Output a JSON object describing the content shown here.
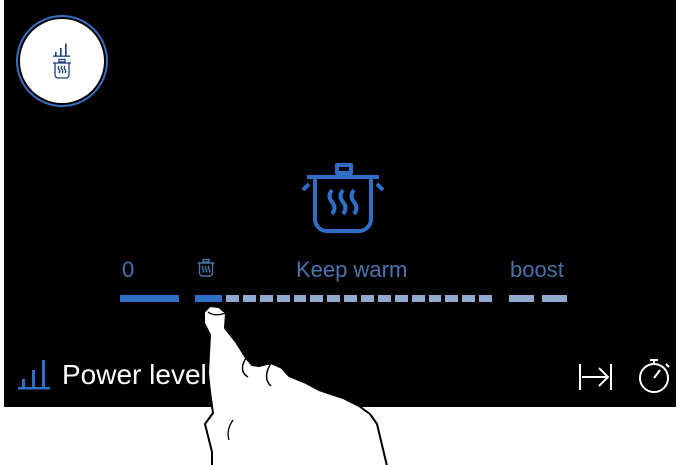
{
  "mode_button": {
    "icons": [
      "bars-icon",
      "steaming-pot-icon"
    ]
  },
  "main_icon": "steaming-pot-icon",
  "scale": {
    "labels": {
      "zero": "0",
      "keep_warm": "Keep warm",
      "boost": "boost"
    },
    "small_icon": "steaming-pot-icon",
    "segments": 16,
    "selected_segment": 1
  },
  "footer": {
    "power_level_label": "Power level",
    "icons": [
      "bars-icon",
      "arrow-to-end-icon",
      "timer-icon"
    ]
  },
  "colors": {
    "background": "#000000",
    "accent_blue": "#2f6fc6",
    "inactive_segment": "#8fa9cf",
    "text_blue": "#4a72aa"
  }
}
